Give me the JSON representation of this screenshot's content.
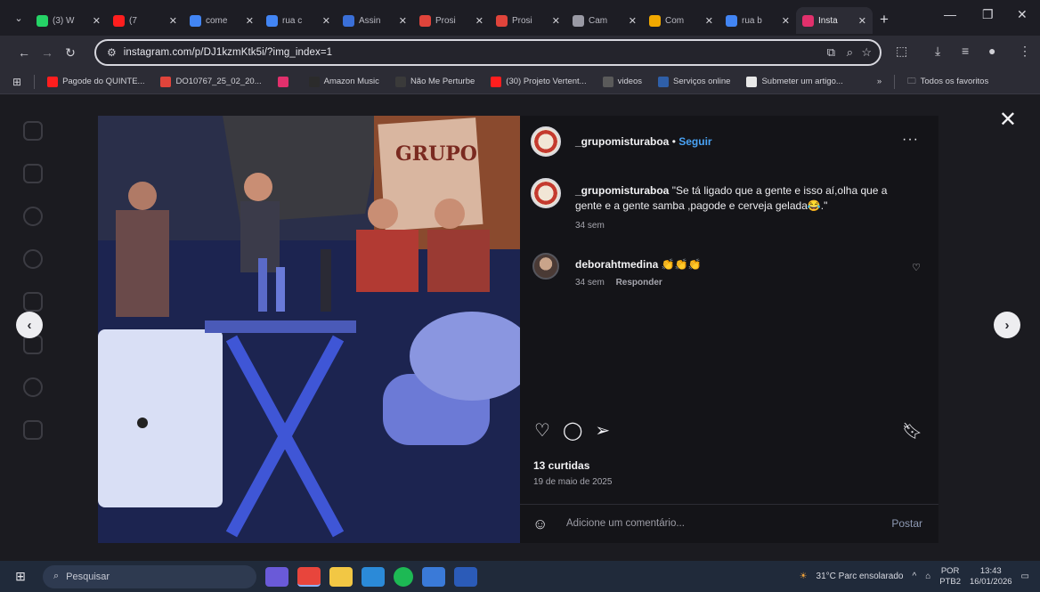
{
  "tabs": [
    {
      "label": "(3) W",
      "color": "#25d366",
      "active": false
    },
    {
      "label": "(7",
      "color": "#ff1e1e",
      "active": false
    },
    {
      "label": "come",
      "color": "#4285f4",
      "active": false
    },
    {
      "label": "rua c",
      "color": "#4285f4",
      "active": false
    },
    {
      "label": "Assin",
      "color": "#3a6fd8",
      "active": false
    },
    {
      "label": "Prosi",
      "color": "#e0443b",
      "active": false
    },
    {
      "label": "Prosi",
      "color": "#e0443b",
      "active": false
    },
    {
      "label": "Cam",
      "color": "#9a9aa5",
      "active": false
    },
    {
      "label": "Com",
      "color": "#f2a900",
      "active": false
    },
    {
      "label": "rua b",
      "color": "#4285f4",
      "active": false
    },
    {
      "label": "Insta",
      "color": "#e1306c",
      "active": true
    }
  ],
  "address": {
    "url": "instagram.com/p/DJ1kzmKtk5i/?img_index=1"
  },
  "bookmarks": [
    {
      "label": "Pagode do QUINTE...",
      "color": "#ff1e1e"
    },
    {
      "label": "DO10767_25_02_20...",
      "color": "#e0443b"
    },
    {
      "label": "",
      "color": "#e1306c"
    },
    {
      "label": "Amazon Music",
      "color": "#2b2b2b"
    },
    {
      "label": "Não Me Perturbe",
      "color": "#3a3a3a"
    },
    {
      "label": "(30) Projeto Vertent...",
      "color": "#ff1e1e"
    },
    {
      "label": "videos",
      "color": "#5a5a5a"
    },
    {
      "label": "Serviços online",
      "color": "#2f5fa8"
    },
    {
      "label": "Submeter um artigo...",
      "color": "#e8e8e8"
    }
  ],
  "bookmarks_overflow": "»",
  "all_bookmarks": "Todos os favoritos",
  "post": {
    "username": "_grupomisturaboa",
    "follow": "Seguir",
    "caption": "\"Se tá ligado que a gente e isso aí,olha que a gente e a gente samba ,pagode e cerveja gelada😂.\"",
    "caption_time": "34 sem",
    "comment": {
      "user": "deborahtmedina",
      "text": "👏👏👏",
      "time": "34 sem",
      "reply": "Responder"
    },
    "likes": "13 curtidas",
    "date": "19 de maio de 2025",
    "comment_placeholder": "Adicione um comentário...",
    "post_button": "Postar",
    "photo_sign": "GRUPO"
  },
  "taskbar": {
    "search_placeholder": "Pesquisar",
    "weather": "31°C Parc ensolarado",
    "lang_top": "POR",
    "lang_bottom": "PTB2",
    "time": "13:43",
    "date": "16/01/2026"
  },
  "colors": {
    "accent_follow": "#4aa3f5",
    "panel_bg": "#141418",
    "photo_blue": "#1f2a55"
  }
}
